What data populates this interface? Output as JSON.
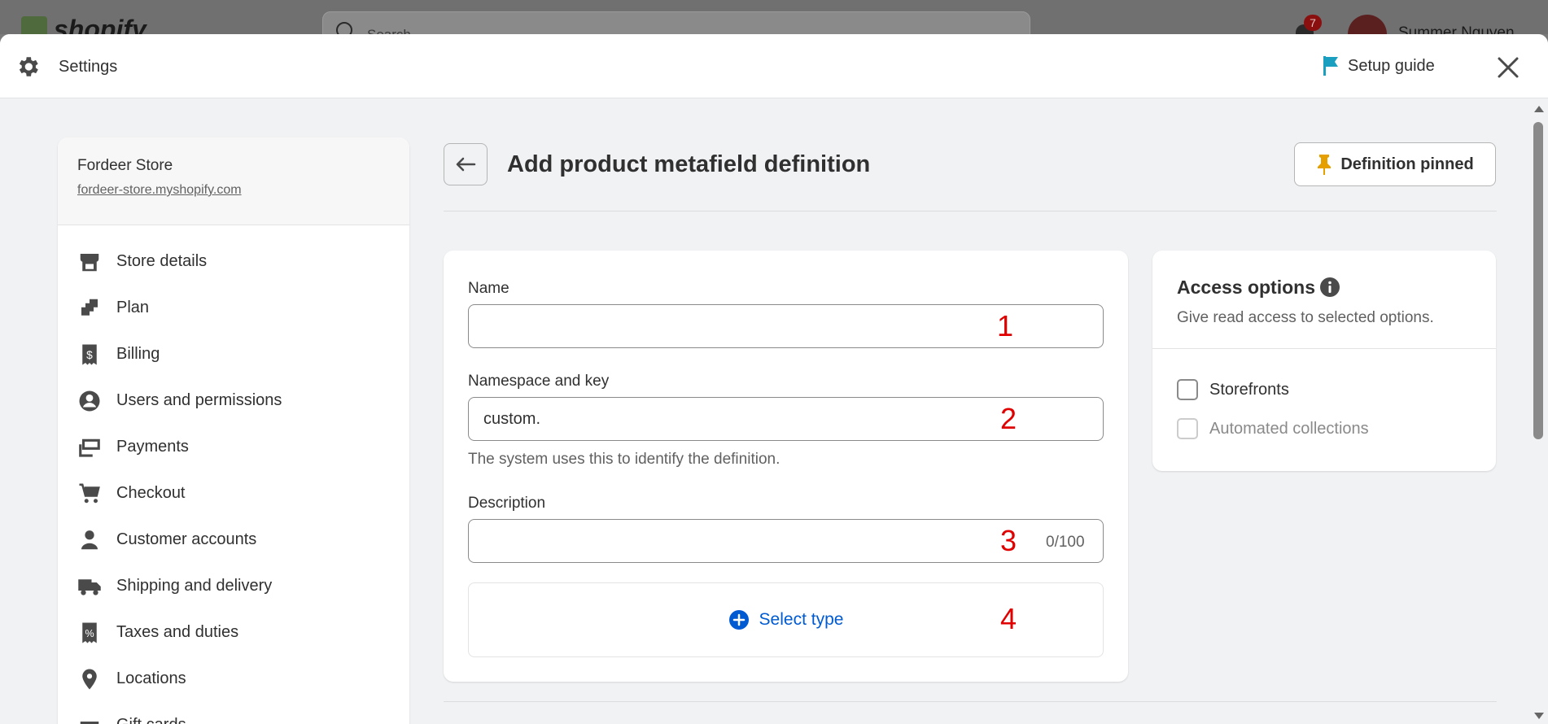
{
  "background": {
    "logo_text": "shopify",
    "search_placeholder": "Search",
    "notification_count": "7",
    "user_name": "Summer Nguyen"
  },
  "header": {
    "title": "Settings",
    "setup_guide_label": "Setup guide",
    "icons": {
      "settings": "gear-icon",
      "setup_guide": "flag-icon",
      "close": "close-icon"
    }
  },
  "sidebar": {
    "store_name": "Fordeer Store",
    "store_url": "fordeer-store.myshopify.com",
    "items": [
      {
        "label": "Store details",
        "icon": "store-icon"
      },
      {
        "label": "Plan",
        "icon": "plan-icon"
      },
      {
        "label": "Billing",
        "icon": "billing-icon"
      },
      {
        "label": "Users and permissions",
        "icon": "user-circle-icon"
      },
      {
        "label": "Payments",
        "icon": "payments-icon"
      },
      {
        "label": "Checkout",
        "icon": "cart-icon"
      },
      {
        "label": "Customer accounts",
        "icon": "person-icon"
      },
      {
        "label": "Shipping and delivery",
        "icon": "truck-icon"
      },
      {
        "label": "Taxes and duties",
        "icon": "tax-icon"
      },
      {
        "label": "Locations",
        "icon": "location-pin-icon"
      },
      {
        "label": "Gift cards",
        "icon": "gift-icon"
      }
    ]
  },
  "page": {
    "title": "Add product metafield definition",
    "pinned_label": "Definition pinned",
    "accent_color": "#005bd3",
    "pin_color": "#e5a000"
  },
  "form": {
    "name_label": "Name",
    "name_value": "",
    "namespace_label": "Namespace and key",
    "namespace_value": "custom.",
    "namespace_help": "The system uses this to identify the definition.",
    "description_label": "Description",
    "description_value": "",
    "description_count": "0/100",
    "select_type_label": "Select type",
    "markers": [
      "1",
      "2",
      "3",
      "4"
    ]
  },
  "access": {
    "title": "Access options",
    "subtitle": "Give read access to selected options.",
    "options": [
      {
        "label": "Storefronts",
        "checked": false,
        "disabled": false
      },
      {
        "label": "Automated collections",
        "checked": false,
        "disabled": true
      }
    ]
  }
}
